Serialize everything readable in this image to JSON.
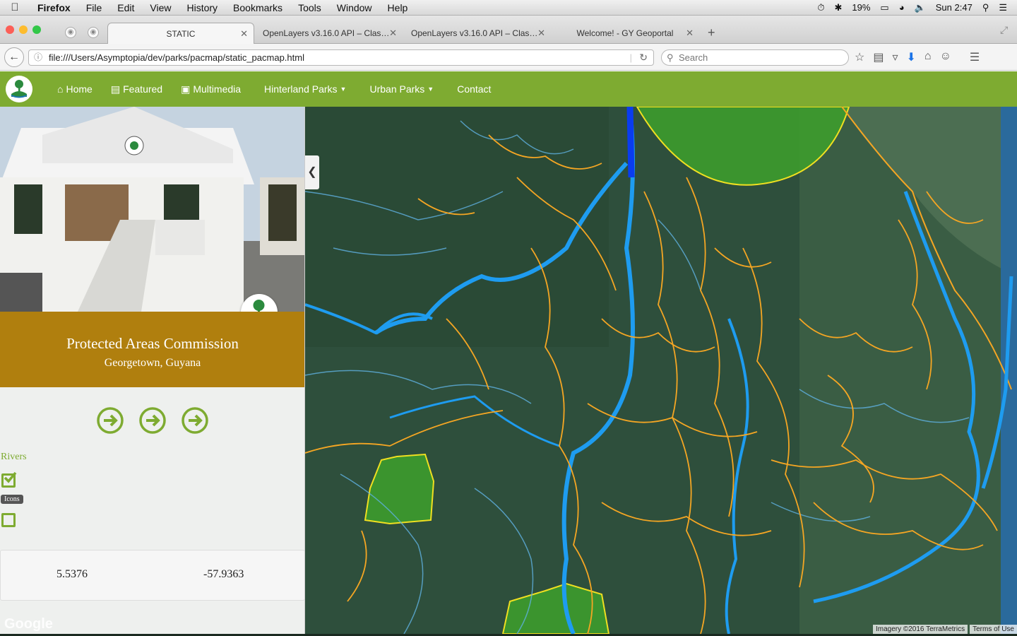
{
  "mac_menubar": {
    "app": "Firefox",
    "items": [
      "File",
      "Edit",
      "View",
      "History",
      "Bookmarks",
      "Tools",
      "Window",
      "Help"
    ],
    "battery": "19%",
    "clock": "Sun 2:47"
  },
  "tabs": [
    {
      "label": "STATIC",
      "active": true
    },
    {
      "label": "OpenLayers v3.16.0 API – Clas…",
      "active": false
    },
    {
      "label": "OpenLayers v3.16.0 API – Clas…",
      "active": false
    },
    {
      "label": "Welcome! - GY Geoportal",
      "active": false
    }
  ],
  "toolbar": {
    "url": "file:///Users/Asymptopia/dev/parks/pacmap/static_pacmap.html",
    "search_placeholder": "Search"
  },
  "sitenav": {
    "items": [
      {
        "label": "Home",
        "icon": "home-icon",
        "dropdown": false
      },
      {
        "label": "Featured",
        "icon": "film-icon",
        "dropdown": false
      },
      {
        "label": "Multimedia",
        "icon": "image-icon",
        "dropdown": false
      },
      {
        "label": "Hinterland Parks",
        "icon": "",
        "dropdown": true
      },
      {
        "label": "Urban Parks",
        "icon": "",
        "dropdown": true
      },
      {
        "label": "Contact",
        "icon": "",
        "dropdown": false
      }
    ],
    "color": "#7eab31"
  },
  "sidebar": {
    "title": "Protected Areas Commission",
    "subtitle": "Georgetown, Guyana",
    "band_color": "#b07f0e",
    "layer_label": "Rivers",
    "rivers_checked": true,
    "tooltip": "Icons",
    "icons_checked": false,
    "coords": {
      "lat": "5.5376",
      "lon": "-57.9363"
    },
    "watermark": "Google"
  },
  "map": {
    "attribution": "Imagery ©2016 TerraMetrics",
    "terms": "Terms of Use",
    "colors": {
      "rivers": "#1e9cf0",
      "roads": "#f5a623",
      "parks": "#3fa52a",
      "park_border": "#f0e020"
    }
  }
}
